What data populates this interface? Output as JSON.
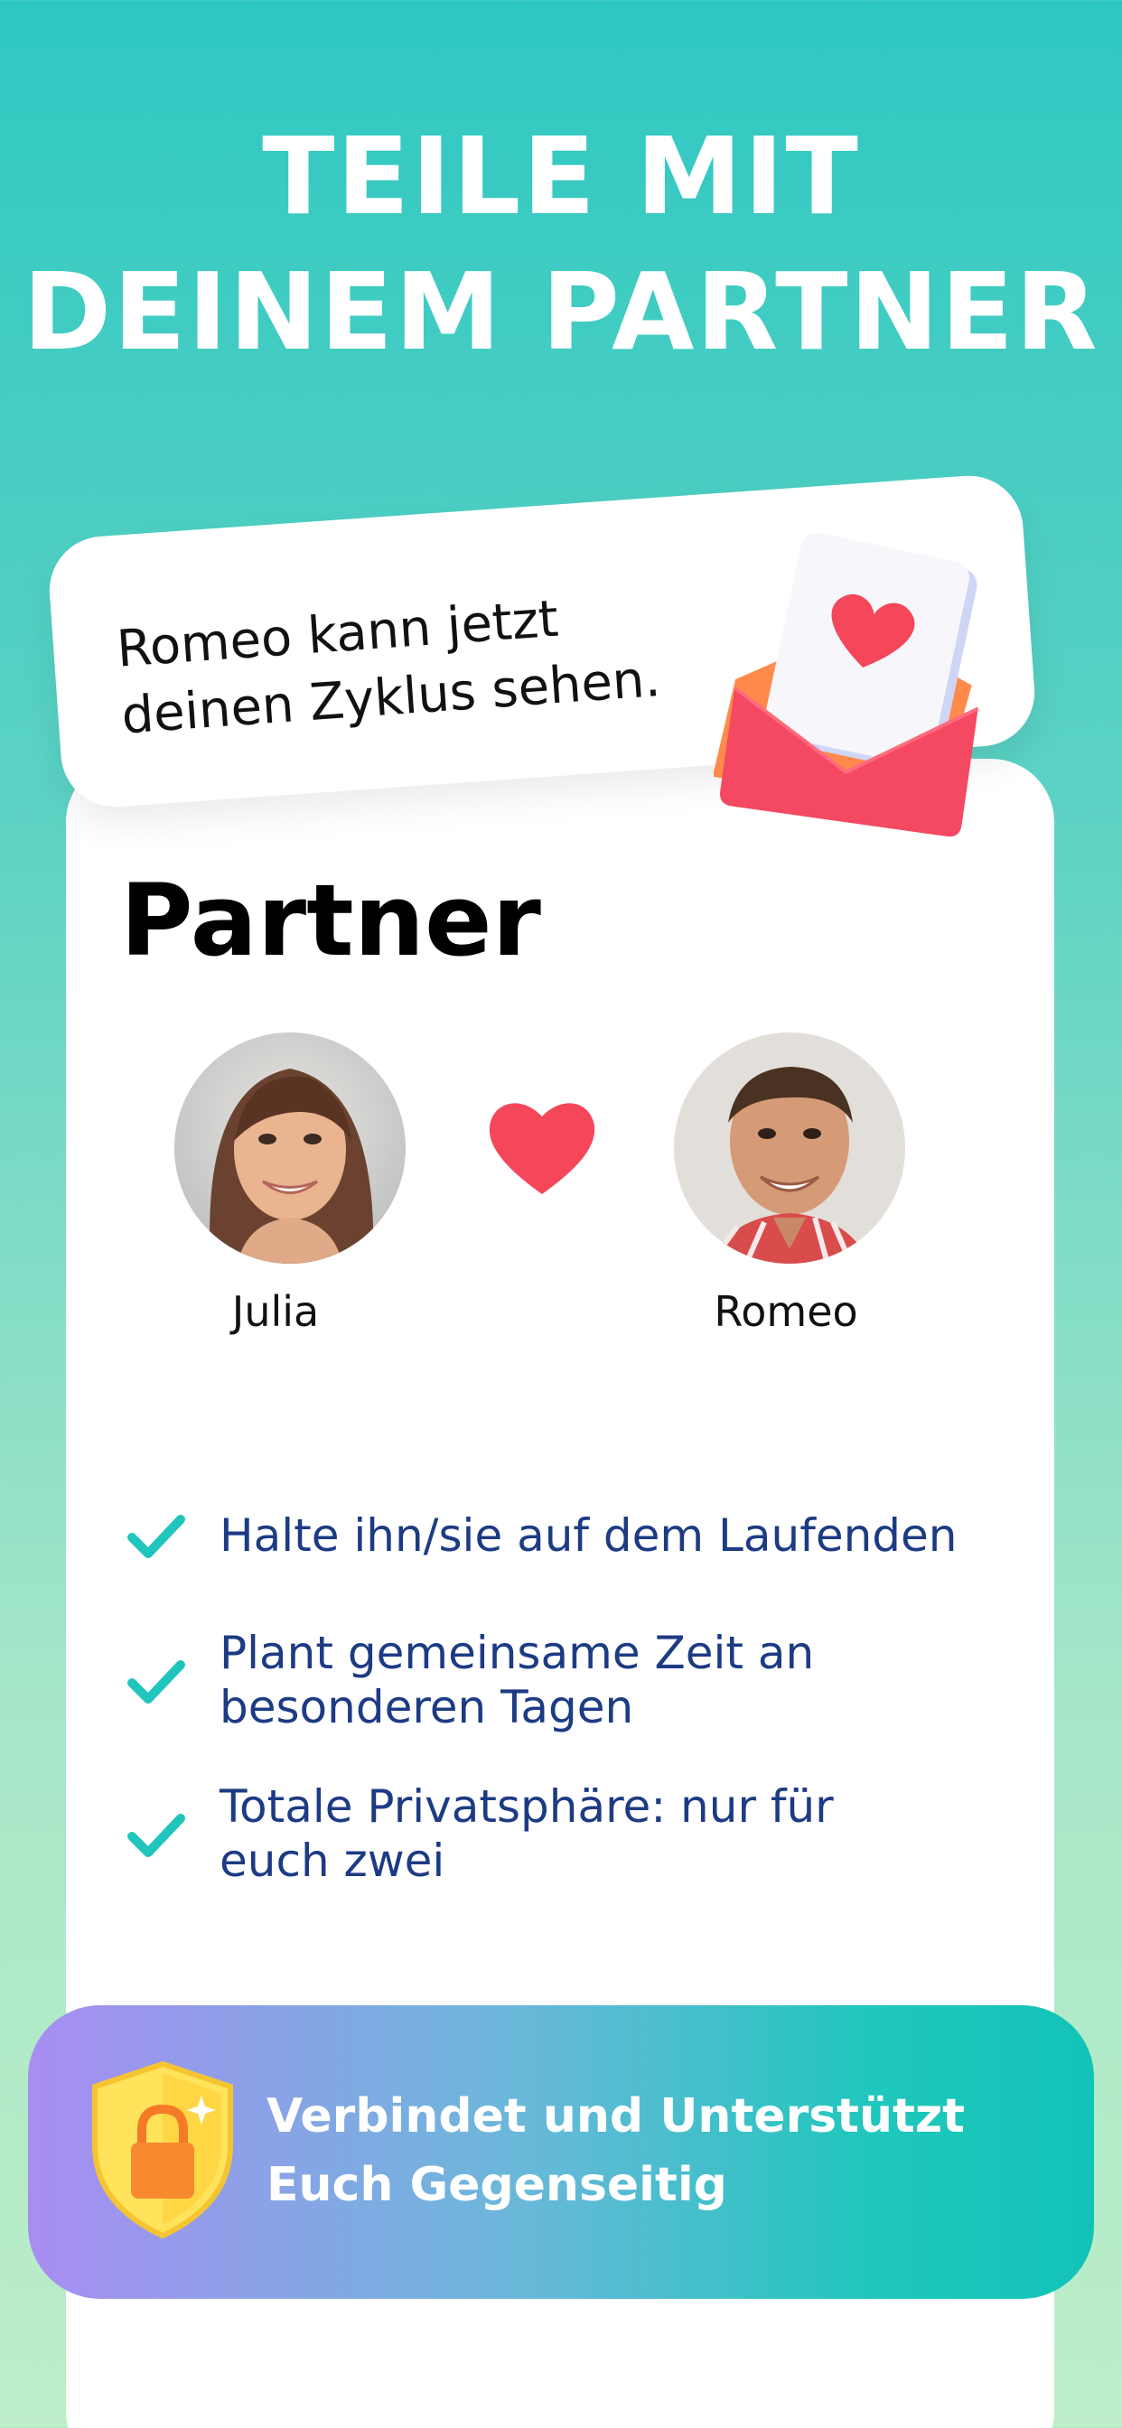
{
  "headline": {
    "line1": "TEILE MIT",
    "line2": "DEINEM PARTNER"
  },
  "notification": {
    "line1": "Romeo kann jetzt",
    "line2": "deinen Zyklus sehen.",
    "icon": "envelope-heart-icon"
  },
  "card": {
    "title": "Partner",
    "partners": [
      {
        "name": "Julia"
      },
      {
        "name": "Romeo"
      }
    ],
    "connector_icon": "heart-icon"
  },
  "features": [
    {
      "line1": "Halte ihn/sie auf dem Laufenden",
      "line2": ""
    },
    {
      "line1": "Plant gemeinsame Zeit an",
      "line2": "besonderen Tagen"
    },
    {
      "line1": "Totale Privatsphäre: nur für",
      "line2": "euch zwei"
    }
  ],
  "banner": {
    "line1": "Verbindet und Unterstützt",
    "line2": "Euch Gegenseitig",
    "icon": "shield-lock-icon"
  },
  "colors": {
    "background_top": "#2ec8c2",
    "background_bottom": "#bdeec9",
    "heart": "#f4475a",
    "check": "#20c5bd",
    "feature_text": "#1d3b84"
  }
}
